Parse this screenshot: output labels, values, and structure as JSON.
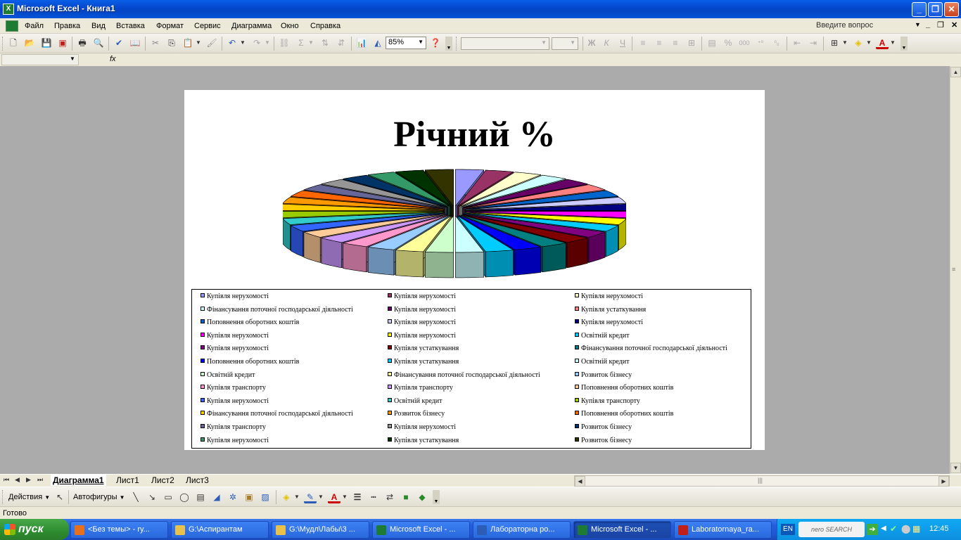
{
  "window": {
    "title": "Microsoft Excel - Книга1",
    "app_icon": "X",
    "minimize_icon": "minimize-icon",
    "maximize_icon": "restore-icon",
    "close_icon": "close-icon"
  },
  "menu": {
    "items": [
      "Файл",
      "Правка",
      "Вид",
      "Вставка",
      "Формат",
      "Сервис",
      "Диаграмма",
      "Окно",
      "Справка"
    ],
    "ask_placeholder": "Введите вопрос"
  },
  "toolbar": {
    "zoom": "85%"
  },
  "formula_bar": {
    "fx": "fx"
  },
  "chart": {
    "title": "Річний %"
  },
  "chart_data": {
    "type": "pie",
    "title": "Річний %",
    "legend_placement": "bottom",
    "series": [
      {
        "name": "Купівля нерухомості",
        "color": "#9999ff"
      },
      {
        "name": "Купівля нерухомості",
        "color": "#993366"
      },
      {
        "name": "Купівля нерухомості",
        "color": "#ffffcc"
      },
      {
        "name": "Фінансування поточної господарської діяльності",
        "color": "#ccffff"
      },
      {
        "name": "Купівля нерухомості",
        "color": "#660066"
      },
      {
        "name": "Купівля устаткування",
        "color": "#ff8080"
      },
      {
        "name": "Поповнення оборотних коштів",
        "color": "#0066cc"
      },
      {
        "name": "Купівля нерухомості",
        "color": "#ccccff"
      },
      {
        "name": "Купівля нерухомості",
        "color": "#000080"
      },
      {
        "name": "Купівля нерухомості",
        "color": "#ff00ff"
      },
      {
        "name": "Купівля нерухомості",
        "color": "#ffff00"
      },
      {
        "name": "Освітній кредит",
        "color": "#00ccff"
      },
      {
        "name": "Купівля нерухомості",
        "color": "#800080"
      },
      {
        "name": "Купівля устаткування",
        "color": "#800000"
      },
      {
        "name": "Фінансування поточної господарської діяльності",
        "color": "#008080"
      },
      {
        "name": "Поповнення оборотних коштів",
        "color": "#0000ff"
      },
      {
        "name": "Купівля устаткування",
        "color": "#00ccff"
      },
      {
        "name": "Освітній кредит",
        "color": "#ccffff"
      },
      {
        "name": "Освітній кредит",
        "color": "#ccffcc"
      },
      {
        "name": "Фінансування поточної господарської діяльності",
        "color": "#ffff99"
      },
      {
        "name": "Розвиток бізнесу",
        "color": "#99ccff"
      },
      {
        "name": "Купівля транспорту",
        "color": "#ff99cc"
      },
      {
        "name": "Купівля транспорту",
        "color": "#cc99ff"
      },
      {
        "name": "Поповнення оборотних коштів",
        "color": "#ffcc99"
      },
      {
        "name": "Купівля нерухомості",
        "color": "#3366ff"
      },
      {
        "name": "Освітній кредит",
        "color": "#33cccc"
      },
      {
        "name": "Купівля транспорту",
        "color": "#99cc00"
      },
      {
        "name": "Фінансування поточної господарської діяльності",
        "color": "#ffcc00"
      },
      {
        "name": "Розвиток бізнесу",
        "color": "#ff9900"
      },
      {
        "name": "Поповнення оборотних коштів",
        "color": "#ff6600"
      },
      {
        "name": "Купівля транспорту",
        "color": "#666699"
      },
      {
        "name": "Купівля нерухомості",
        "color": "#969696"
      },
      {
        "name": "Розвиток бізнесу",
        "color": "#003366"
      },
      {
        "name": "Купівля нерухомості",
        "color": "#339966"
      },
      {
        "name": "Купівля устаткування",
        "color": "#003300"
      },
      {
        "name": "Розвиток бізнесу",
        "color": "#333300"
      }
    ]
  },
  "sheet_tabs": [
    "Диаграмма1",
    "Лист1",
    "Лист2",
    "Лист3"
  ],
  "draw_toolbar": {
    "actions": "Действия",
    "autoshapes": "Автофигуры"
  },
  "status": "Готово",
  "taskbar": {
    "start": "пуск",
    "tasks": [
      {
        "label": "<Без темы> - ry...",
        "color": "#e8701a"
      },
      {
        "label": "G:\\Аспирантам",
        "color": "#e8c14a"
      },
      {
        "label": "G:\\Мудл\\Лабы\\3 ...",
        "color": "#e8c14a"
      },
      {
        "label": "Microsoft Excel - ...",
        "color": "#1e7b34"
      },
      {
        "label": "Лабораторна ро...",
        "color": "#2b5cb8"
      },
      {
        "label": "Microsoft Excel - ...",
        "color": "#1e7b34"
      },
      {
        "label": "Laboratornaya_ra...",
        "color": "#c0201a"
      }
    ],
    "lang": "EN",
    "nero": "nero SEARCH",
    "clock": "12:45"
  }
}
